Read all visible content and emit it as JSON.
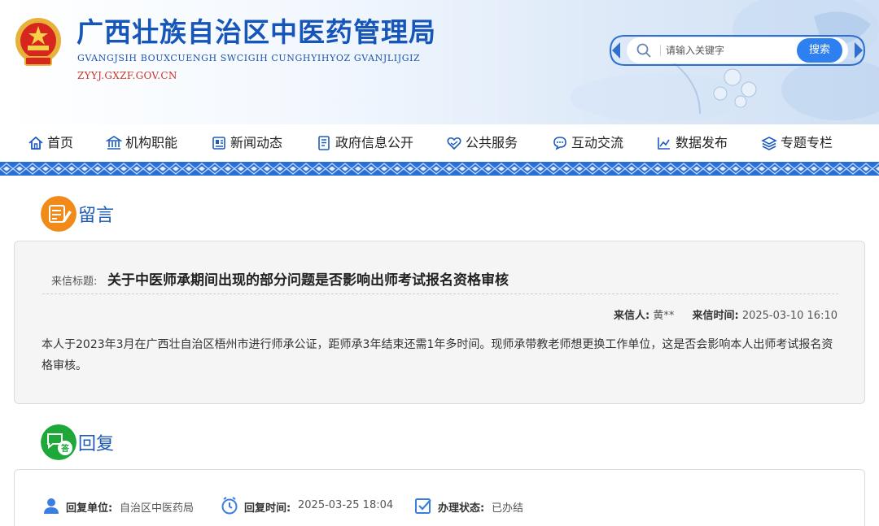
{
  "header": {
    "title": "广西壮族自治区中医药管理局",
    "subtitle": "GVANGJSIH BOUXCUENGH SWCIGIH CUNGHYIHYOZ GVANJLIJGIZ",
    "domain": "ZYYJ.GXZF.GOV.CN"
  },
  "search": {
    "placeholder": "请输入关键字",
    "value": "",
    "button_label": "搜索"
  },
  "nav": {
    "items": [
      {
        "label": "首页",
        "icon": "home-icon"
      },
      {
        "label": "机构职能",
        "icon": "institution-icon"
      },
      {
        "label": "新闻动态",
        "icon": "news-icon"
      },
      {
        "label": "政府信息公开",
        "icon": "document-icon"
      },
      {
        "label": "公共服务",
        "icon": "heart-hands-icon"
      },
      {
        "label": "互动交流",
        "icon": "chat-icon"
      },
      {
        "label": "数据发布",
        "icon": "chart-icon"
      },
      {
        "label": "专题专栏",
        "icon": "layers-icon"
      }
    ]
  },
  "message_section": {
    "title": "留言",
    "subject_label": "来信标题:",
    "subject": "关于中医师承期间出现的部分问题是否影响出师考试报名资格审核",
    "sender_label": "来信人:",
    "sender": "黄**",
    "time_label": "来信时间:",
    "time": "2025-03-10 16:10",
    "body": "本人于2023年3月在广西壮自治区梧州市进行师承公证，距师承3年结束还需1年多时间。现师承带教老师想更换工作单位，这是否会影响本人出师考试报名资格审核。"
  },
  "reply_section": {
    "title": "回复",
    "unit_label": "回复单位:",
    "unit": "自治区中医药局",
    "time_label": "回复时间:",
    "time": "2025-03-25 18:04",
    "status_label": "办理状态:",
    "status": "已办结"
  },
  "colors": {
    "brand_blue": "#1656b9",
    "accent_blue": "#2e7ff0",
    "orange": "#f28a1a",
    "green": "#1fa83a",
    "domain_red": "#c9352b"
  }
}
